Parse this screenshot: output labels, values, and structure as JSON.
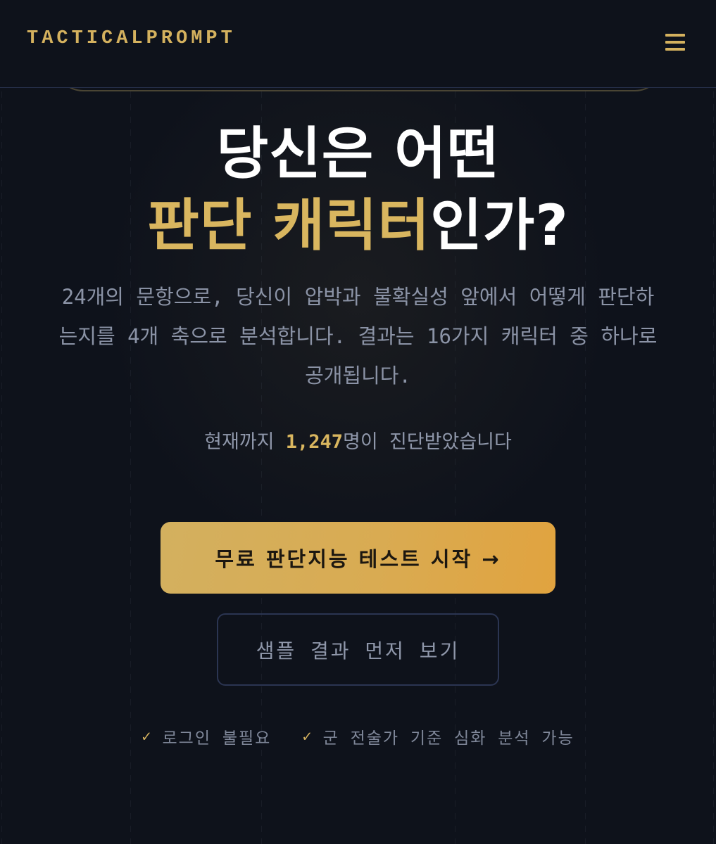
{
  "header": {
    "logo": "TACTICALPROMPT",
    "menu_icon": "hamburger-menu-icon"
  },
  "hero": {
    "title_line1": "당신은 어떤",
    "title_highlight": "판단 캐릭터",
    "title_rest": "인가?",
    "description_lines": [
      "24개의 문항으로, 당신이 압박과 불확실성 앞에서 어떻게 판단하",
      "는지를 4개 축으로 분석합니다. 결과는 16가지 캐릭터 중 하나로",
      "공개됩니다."
    ],
    "count_prefix": "현재까지 ",
    "count_value": "1,247",
    "count_suffix": "명이 진단받았습니다"
  },
  "actions": {
    "primary_label": "무료 판단지능 테스트 시작 →",
    "secondary_label": "샘플 결과 먼저 보기"
  },
  "features": [
    {
      "icon": "check-icon",
      "check": "✓",
      "label": "로그인 불필요"
    },
    {
      "icon": "check-icon",
      "check": "✓",
      "label": "군 전술가 기준 심화 분석 가능"
    }
  ],
  "colors": {
    "background": "#0e121b",
    "accent_gold": "#d9b65f",
    "text_muted": "#8b93a6",
    "button_gradient_end": "#e1a33f"
  }
}
